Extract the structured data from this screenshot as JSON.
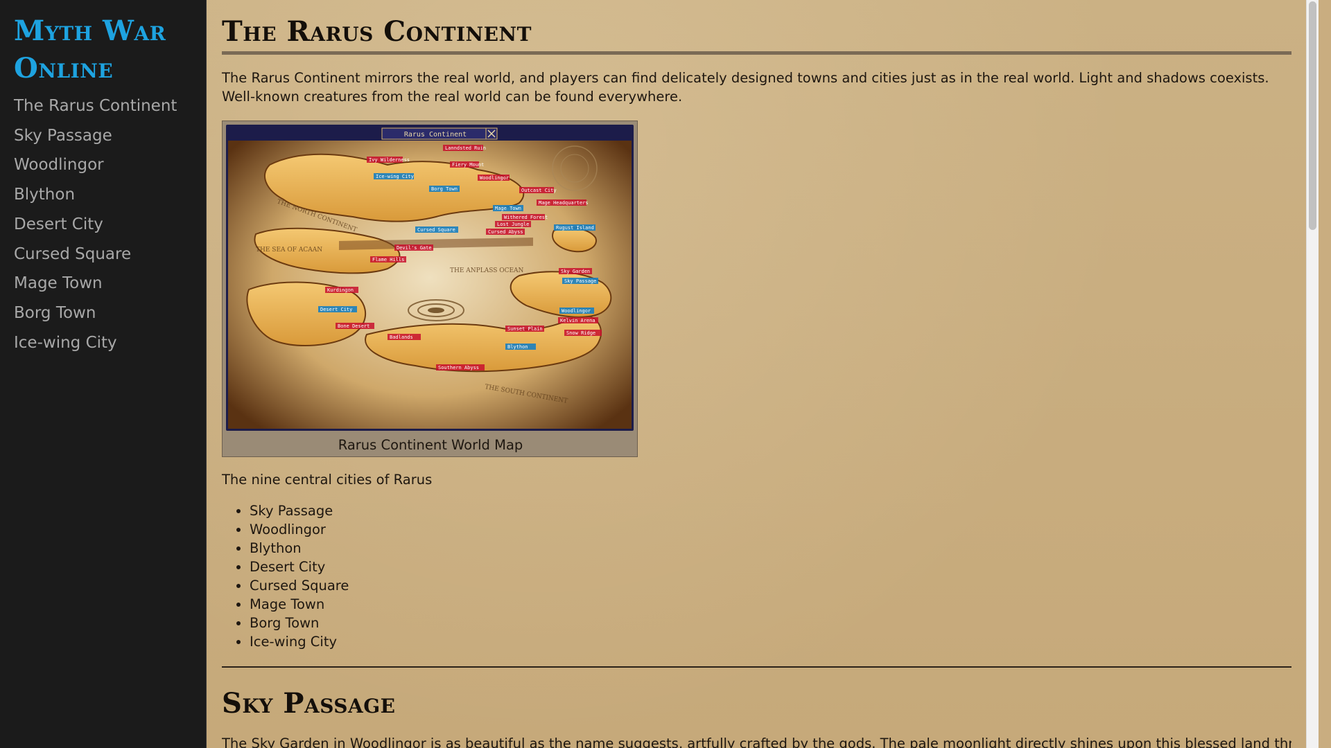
{
  "sidebar": {
    "site_title": "Myth War Online",
    "nav": [
      "The Rarus Continent",
      "Sky Passage",
      "Woodlingor",
      "Blython",
      "Desert City",
      "Cursed Square",
      "Mage Town",
      "Borg Town",
      "Ice-wing City"
    ]
  },
  "main": {
    "section1": {
      "title": "The Rarus Continent",
      "intro": "The Rarus Continent mirrors the real world, and players can find delicately designed towns and cities just as in the real world. Light and shadows coexists. Well-known creatures from the real world can be found everywhere.",
      "figure": {
        "caption": "Rarus Continent World Map",
        "map_header": "Rarus Continent",
        "map_labels": [
          "Lanndsted Ruin",
          "Ivy Wilderness",
          "Fiery Mount",
          "Ice-wing City",
          "Woodlingor",
          "Borg Town",
          "Outcast City",
          "Mage Headquarters",
          "Mage Town",
          "Withered Forest",
          "Cursed Square",
          "Lost Jungle",
          "Cursed Abyss",
          "Rugust Island",
          "Devil's Gate",
          "Flame Hills",
          "Sky Garden",
          "Sky Passage",
          "Kurdingon",
          "Desert City",
          "Woodlingor",
          "Sunset Plain",
          "Kelvin Arena",
          "Snow Ridge",
          "Bone Desert",
          "Badlands",
          "Blython",
          "Southern Abyss"
        ],
        "map_region_labels": [
          "THE NORTH CONTINENT",
          "THE SEA OF ACAAN",
          "THE ANPLASS OCEAN",
          "THE SOUTH CONTINENT"
        ]
      },
      "cities_intro": "The nine central cities of Rarus",
      "cities": [
        "Sky Passage",
        "Woodlingor",
        "Blython",
        "Desert City",
        "Cursed Square",
        "Mage Town",
        "Borg Town",
        "Ice-wing City"
      ]
    },
    "section2": {
      "title": "Sky Passage",
      "text": "The Sky Garden in Woodlingor is as beautiful as the name suggests, artfully crafted by the gods. The pale moonlight directly shines upon this blessed land through"
    }
  },
  "colors": {
    "sidebar_bg": "#1b1b1b",
    "title_accent": "#1ea3e0",
    "nav_text": "#a8a8a8",
    "parchment": "#c9ad80"
  }
}
